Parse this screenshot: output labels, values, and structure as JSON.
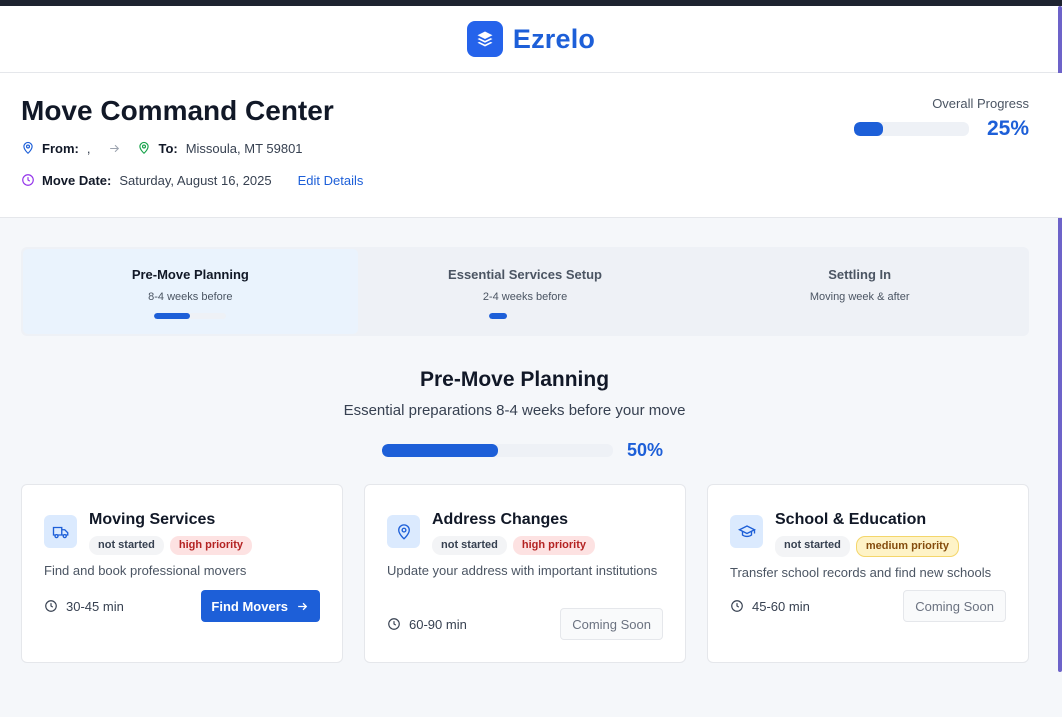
{
  "brand": {
    "name": "Ezrelo"
  },
  "header": {
    "title": "Move Command Center",
    "from_label": "From:",
    "from_value": ",",
    "to_label": "To:",
    "to_value": "Missoula, MT 59801",
    "date_label": "Move Date:",
    "date_value": "Saturday, August 16, 2025",
    "edit_label": "Edit Details",
    "overall_label": "Overall Progress",
    "overall_pct": "25%",
    "overall_value": 0.25
  },
  "phases": [
    {
      "title": "Pre-Move Planning",
      "sub": "8-4 weeks before",
      "progress": 0.5,
      "active": true
    },
    {
      "title": "Essential Services Setup",
      "sub": "2-4 weeks before",
      "progress": 0.25,
      "active": false
    },
    {
      "title": "Settling In",
      "sub": "Moving week & after",
      "progress": 0,
      "active": false
    }
  ],
  "section": {
    "title": "Pre-Move Planning",
    "subtitle": "Essential preparations 8-4 weeks before your move",
    "pct": "50%",
    "value": 0.5
  },
  "cards": [
    {
      "title": "Moving Services",
      "status": "not started",
      "priority": "high priority",
      "priority_level": "high",
      "desc": "Find and book professional movers",
      "duration": "30-45 min",
      "action": "Find Movers",
      "icon": "truck-icon"
    },
    {
      "title": "Address Changes",
      "status": "not started",
      "priority": "high priority",
      "priority_level": "high",
      "desc": "Update your address with important institutions",
      "duration": "60-90 min",
      "action": "Coming Soon",
      "icon": "map-pin-icon"
    },
    {
      "title": "School & Education",
      "status": "not started",
      "priority": "medium priority",
      "priority_level": "medium",
      "desc": "Transfer school records and find new schools",
      "duration": "45-60 min",
      "action": "Coming Soon",
      "icon": "graduation-cap-icon"
    }
  ],
  "colors": {
    "accent": "#1d5fd8",
    "from_pin": "#1d5fd8",
    "to_pin": "#16a34a",
    "date_clock": "#9333ea"
  }
}
